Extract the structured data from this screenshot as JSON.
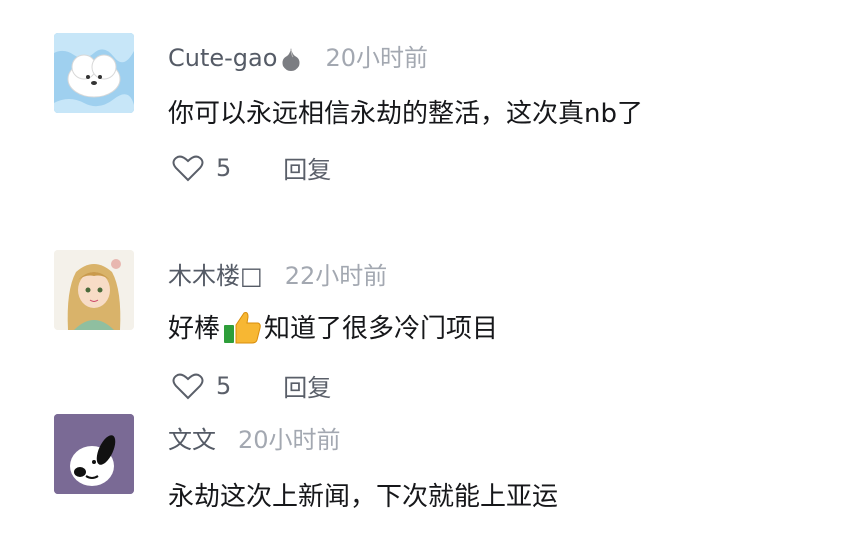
{
  "comments": [
    {
      "username": "Cute-gao",
      "username_suffix_icon": "garlic-emoji",
      "time": "20小时前",
      "text": "你可以永远相信永劫的整活，这次真nb了",
      "likes": "5",
      "reply_label": "回复",
      "avatar": "white-dog-cartoon-blue-background"
    },
    {
      "username": "木木楼",
      "username_suffix": "□",
      "time": "22小时前",
      "text_before": "好棒",
      "text_emoji": "thumbs-up-emoji",
      "text_after": "知道了很多冷门项目",
      "likes": "5",
      "reply_label": "回复",
      "avatar": "anime-girl-avatar"
    },
    {
      "username": "文文",
      "time": "20小时前",
      "text": "永劫这次上新闻，下次就能上亚运",
      "avatar": "snoopy-purple-background"
    }
  ],
  "colors": {
    "username": "#555b66",
    "time": "#a3a8b1",
    "text": "#16171a",
    "actions": "#5a5f69"
  }
}
